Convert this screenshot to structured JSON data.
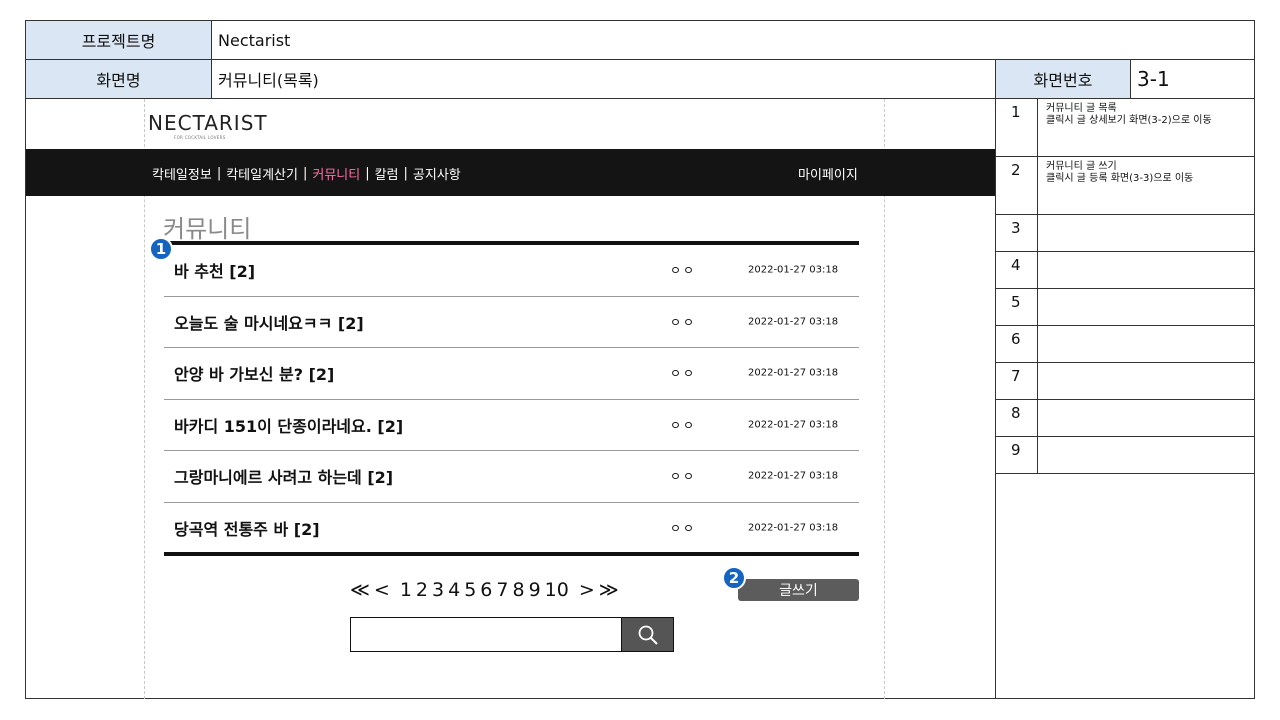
{
  "header": {
    "project_label": "프로젝트명",
    "project_value": "Nectarist",
    "screen_label": "화면명",
    "screen_value": "커뮤니티(목록)",
    "screen_no_label": "화면번호",
    "screen_no_value": "3-1"
  },
  "site": {
    "logo": "NECTARIST",
    "logo_sub": "FOR COCKTAIL LOVERS",
    "nav": [
      {
        "label": "칵테일정보",
        "active": false
      },
      {
        "label": "칵테일계산기",
        "active": false
      },
      {
        "label": "커뮤니티",
        "active": true
      },
      {
        "label": "칼럼",
        "active": false
      },
      {
        "label": "공지사항",
        "active": false
      }
    ],
    "nav_separator": "|",
    "mypage": "마이페이지"
  },
  "page": {
    "title": "커뮤니티"
  },
  "posts": [
    {
      "title": "바 추천 [2]",
      "author": "ㅇㅇ",
      "date": "2022-01-27  03:18"
    },
    {
      "title": "오늘도 술 마시네요ㅋㅋ [2]",
      "author": "ㅇㅇ",
      "date": "2022-01-27  03:18"
    },
    {
      "title": "안양 바 가보신 분? [2]",
      "author": "ㅇㅇ",
      "date": "2022-01-27  03:18"
    },
    {
      "title": "바카디 151이 단종이라네요. [2]",
      "author": "ㅇㅇ",
      "date": "2022-01-27  03:18"
    },
    {
      "title": "그랑마니에르 사려고 하는데 [2]",
      "author": "ㅇㅇ",
      "date": "2022-01-27  03:18"
    },
    {
      "title": "당곡역 전통주 바 [2]",
      "author": "ㅇㅇ",
      "date": "2022-01-27  03:18"
    }
  ],
  "pagination": {
    "first": "≪",
    "prev": "<",
    "pages": [
      "1",
      "2",
      "3",
      "4",
      "5",
      "6",
      "7",
      "8",
      "9",
      "10"
    ],
    "next": ">",
    "last": "≫"
  },
  "write_button": "글쓰기",
  "search": {
    "value": "",
    "placeholder": "",
    "icon": "search-icon"
  },
  "badges": {
    "b1": "1",
    "b2": "2",
    "color": "#1565c0"
  },
  "colors": {
    "header_label_bg": "#dae6f3",
    "navbar_bg": "#141414",
    "nav_active": "#ff6fa8",
    "write_button_bg": "#5c5c5c"
  },
  "descriptions": [
    {
      "num": "1",
      "text": "커뮤니티 글 목록\n클릭시 글 상세보기 화면(3-2)으로 이동"
    },
    {
      "num": "2",
      "text": "커뮤니티 글 쓰기\n클릭시 글 등록 화면(3-3)으로 이동"
    },
    {
      "num": "3",
      "text": ""
    },
    {
      "num": "4",
      "text": ""
    },
    {
      "num": "5",
      "text": ""
    },
    {
      "num": "6",
      "text": ""
    },
    {
      "num": "7",
      "text": ""
    },
    {
      "num": "8",
      "text": ""
    },
    {
      "num": "9",
      "text": ""
    }
  ]
}
